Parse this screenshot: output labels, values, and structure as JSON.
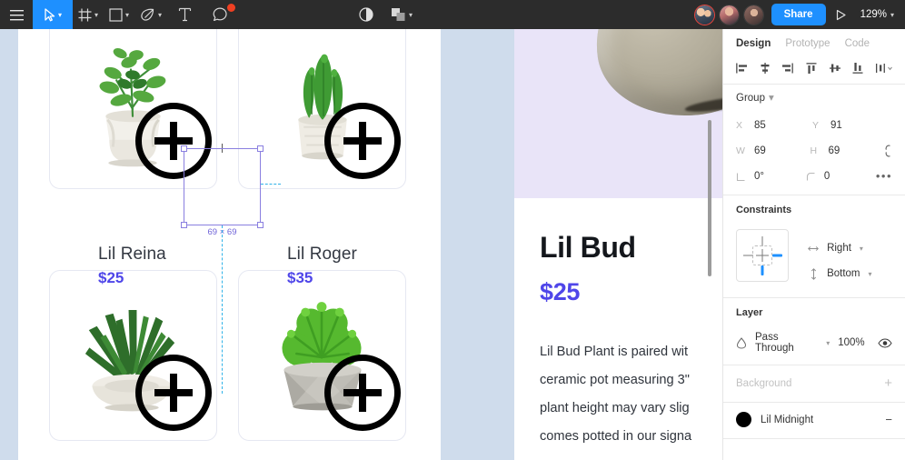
{
  "toolbar": {
    "menu_icon": "hamburger-menu-icon",
    "tools": [
      {
        "name": "move-tool",
        "icon": "cursor-icon",
        "active": true,
        "has_caret": true
      },
      {
        "name": "frame-tool",
        "icon": "frame-icon",
        "active": false,
        "has_caret": true
      },
      {
        "name": "shape-tool",
        "icon": "square-icon",
        "active": false,
        "has_caret": true
      },
      {
        "name": "pen-tool",
        "icon": "pen-icon",
        "active": false,
        "has_caret": true
      },
      {
        "name": "text-tool",
        "icon": "text-t-icon",
        "active": false,
        "has_caret": false
      },
      {
        "name": "comment-tool",
        "icon": "comment-bubble-icon",
        "active": false,
        "has_caret": false
      }
    ],
    "center_tools": [
      {
        "name": "mask-tool",
        "icon": "half-circle-icon"
      },
      {
        "name": "boolean-tool",
        "icon": "union-shapes-icon",
        "has_caret": true
      }
    ],
    "share_label": "Share",
    "present_icon": "play-triangle-icon",
    "zoom_level": "129%",
    "collaborators": [
      "collaborator-1",
      "collaborator-2",
      "collaborator-3"
    ]
  },
  "canvas": {
    "cards": [
      {
        "title": "Lil Reina",
        "price": "$25",
        "plant": "trailing-succulent-white-pot",
        "add_icon": "plus-circle-icon"
      },
      {
        "title": "Lil Roger",
        "price": "$35",
        "plant": "tall-cactus-white-textured-pot",
        "add_icon": "plus-circle-icon"
      },
      {
        "title": "",
        "price": "",
        "plant": "spiky-grass-white-bowl",
        "add_icon": "plus-circle-icon"
      },
      {
        "title": "",
        "price": "",
        "plant": "green-succulent-concrete-bowl",
        "add_icon": "plus-circle-icon"
      }
    ],
    "selection": {
      "dimension_label": "69 × 69"
    },
    "detail": {
      "title": "Lil Bud",
      "price": "$25",
      "body": "Lil Bud Plant is paired wit\nceramic pot measuring 3\"\nplant height may vary slig\ncomes potted in our signa"
    }
  },
  "panel": {
    "tabs": [
      {
        "label": "Design",
        "active": true
      },
      {
        "label": "Prototype",
        "active": false
      },
      {
        "label": "Code",
        "active": false
      }
    ],
    "align_icons": [
      "align-left-icon",
      "align-horizontal-center-icon",
      "align-right-icon",
      "align-top-icon",
      "align-vertical-center-icon",
      "align-bottom-icon",
      "distribute-more-icon"
    ],
    "group": {
      "label": "Group",
      "caret": "chevron-down-icon"
    },
    "properties": {
      "x": {
        "label": "X",
        "value": "85"
      },
      "y": {
        "label": "Y",
        "value": "91"
      },
      "w": {
        "label": "W",
        "value": "69"
      },
      "h": {
        "label": "H",
        "value": "69"
      },
      "rotation": {
        "label": "angle-icon",
        "value": "0°"
      },
      "corner_radius": {
        "label": "corner-radius-icon",
        "value": "0"
      },
      "constrain_proportions_icon": "link-broken-icon",
      "more_options_icon": "ellipsis-icon"
    },
    "constraints": {
      "heading": "Constraints",
      "horizontal": {
        "icon": "horizontal-arrows-icon",
        "value": "Right"
      },
      "vertical": {
        "icon": "vertical-arrows-icon",
        "value": "Bottom"
      }
    },
    "layer": {
      "heading": "Layer",
      "blend_icon": "blend-mode-icon",
      "blend_mode": "Pass Through",
      "opacity": "100%",
      "visibility_icon": "eye-icon"
    },
    "background": {
      "heading": "Background",
      "add_icon": "plus-icon"
    },
    "style": {
      "swatch_color": "#000000",
      "name": "Lil Midnight",
      "remove_icon": "minus-icon"
    }
  },
  "colors": {
    "toolbar_bg": "#2c2c2c",
    "accent_blue": "#1e90ff",
    "price_purple": "#4f46e9",
    "strip_blue": "#cfdcec",
    "hero_lavender": "#e9e4f8",
    "selection_purple": "#8a7fe0",
    "guide_cyan": "#2fb2e8"
  }
}
